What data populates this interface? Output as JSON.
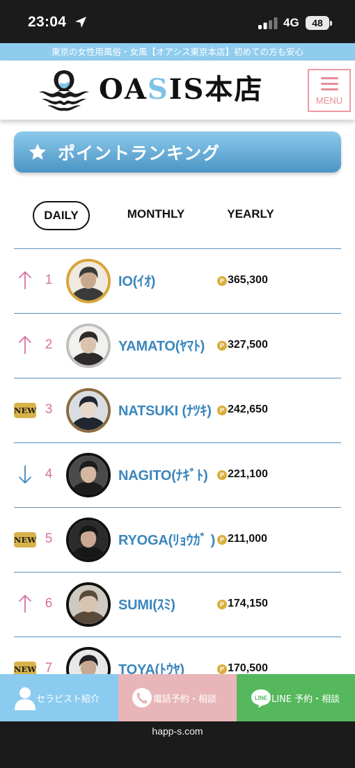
{
  "status_bar": {
    "time": "23:04",
    "network": "4G",
    "battery": "48"
  },
  "tagline": "東京の女性用風俗・女風【オアシス東京本店】初めての方も安心",
  "header": {
    "logo_prefix": "OA",
    "logo_accent": "S",
    "logo_suffix": "IS",
    "logo_kanji": "本店",
    "menu_label": "MENU"
  },
  "section": {
    "title": "ポイントランキング"
  },
  "tabs": [
    {
      "label": "DAILY",
      "active": true
    },
    {
      "label": "MONTHLY",
      "active": false
    },
    {
      "label": "YEARLY",
      "active": false
    }
  ],
  "ranking": [
    {
      "trend": "up",
      "rank": "1",
      "name": "IO(ｲｵ)",
      "points": "365,300",
      "ring": "#d7a63a"
    },
    {
      "trend": "up",
      "rank": "2",
      "name": "YAMATO(ﾔﾏﾄ)",
      "points": "327,500",
      "ring": "#bfbfbf"
    },
    {
      "trend": "new",
      "badge": "NEW",
      "rank": "3",
      "name": "NATSUKI (ﾅﾂｷ)",
      "points": "242,650",
      "ring": "#8a6a3f"
    },
    {
      "trend": "down",
      "rank": "4",
      "name": "NAGITO(ﾅｷﾞﾄ)",
      "points": "221,100",
      "ring": "#111111"
    },
    {
      "trend": "new",
      "badge": "NEW",
      "rank": "5",
      "name": "RYOGA(ﾘｮｳｶﾞ )",
      "points": "211,000",
      "ring": "#111111"
    },
    {
      "trend": "up",
      "rank": "6",
      "name": "SUMI(ｽﾐ)",
      "points": "174,150",
      "ring": "#111111"
    },
    {
      "trend": "new",
      "badge": "NEW",
      "rank": "7",
      "name": "TOYA(ﾄｳﾔ)",
      "points": "170,500",
      "ring": "#111111"
    }
  ],
  "point_icon_letter": "P",
  "bottom_bar": {
    "therapist": "セラピスト紹介",
    "phone": "電話予約・相談",
    "line_icon": "LINE",
    "line": "LINE 予約・相談"
  },
  "browser": {
    "url": "happ-s.com"
  },
  "colors": {
    "tagline_bg": "#8fcdee",
    "accent_blue": "#3a86bc",
    "rank_pink": "#d870a4",
    "trend_up": "#d870a4",
    "trend_down": "#3a86bc",
    "new_badge": "#d8b24a",
    "menu_pink": "#e98a94",
    "line_green": "#55b85d"
  }
}
